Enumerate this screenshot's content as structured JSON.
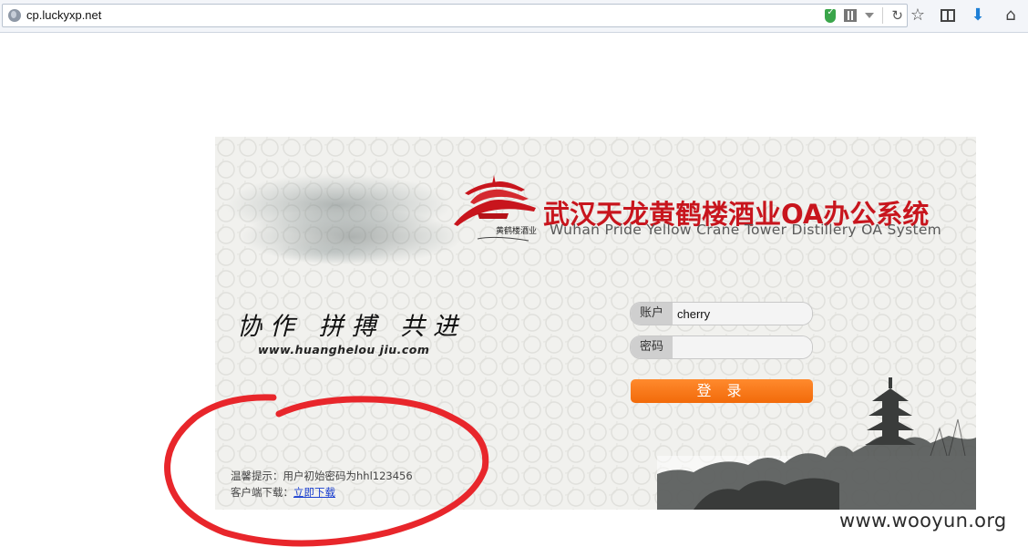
{
  "browser": {
    "url": "cp.luckyxp.net",
    "icons": [
      "globe-icon",
      "shield-icon",
      "qr-code-icon",
      "dropdown-icon",
      "reload-icon",
      "bookmark-star-icon",
      "reader-icon",
      "download-icon",
      "home-icon"
    ]
  },
  "page": {
    "title_cn": "武汉天龙黄鹤楼酒业OA办公系统",
    "title_en": "Wuhan Pride Yellow Crane Tower Distillery OA System",
    "logo_text": "黄鹤楼酒业",
    "motto": "协作 拼搏 共进",
    "website": "www.huanghelou jiu.com",
    "login": {
      "account_label": "账户",
      "account_value": "cherry",
      "password_label": "密码",
      "password_value": "",
      "button_label": "登 录"
    },
    "hint_text": "温馨提示：用户初始密码为hhl123456",
    "download_prefix": "客户端下载：",
    "download_link": "立即下载"
  },
  "watermark": "www.wooyun.org",
  "colors": {
    "title_red": "#c8151d",
    "button_orange": "#f26a0a",
    "annotation_red": "#e8262b",
    "link_blue": "#1a3fd0"
  }
}
